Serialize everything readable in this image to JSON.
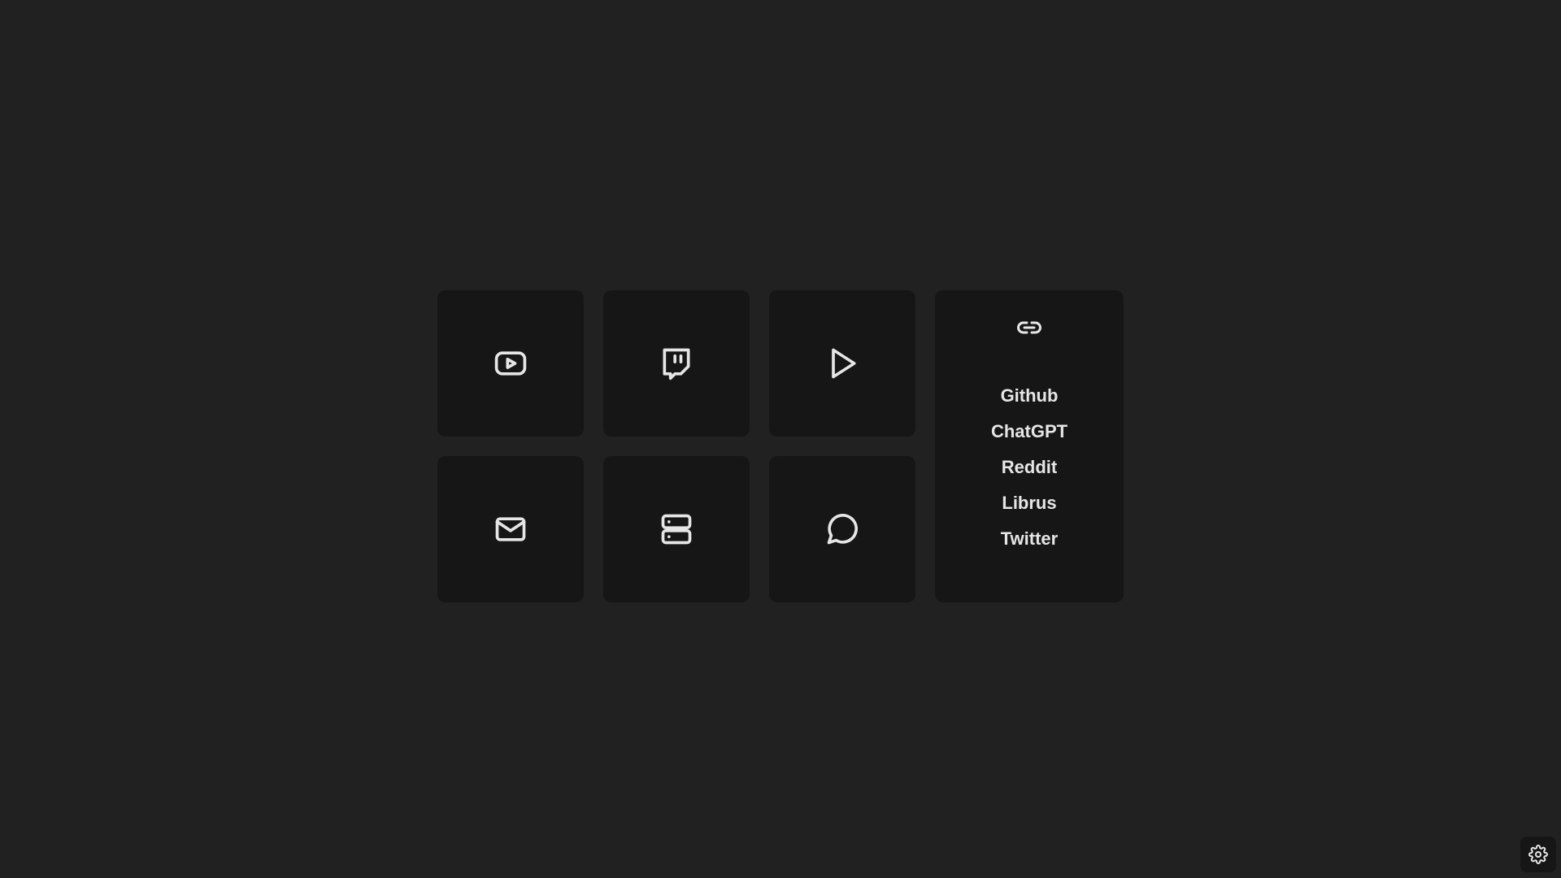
{
  "tiles": [
    {
      "icon": "youtube-icon"
    },
    {
      "icon": "twitch-icon"
    },
    {
      "icon": "play-icon"
    },
    {
      "icon": "mail-icon"
    },
    {
      "icon": "server-icon"
    },
    {
      "icon": "chat-bubble-icon"
    }
  ],
  "links_panel": {
    "icon": "link-icon",
    "items": [
      {
        "label": "Github"
      },
      {
        "label": "ChatGPT"
      },
      {
        "label": "Reddit"
      },
      {
        "label": "Librus"
      },
      {
        "label": "Twitter"
      }
    ]
  },
  "settings": {
    "icon": "gear-icon"
  },
  "colors": {
    "background": "#212121",
    "tile": "#161616",
    "foreground": "#e6e6e6"
  }
}
